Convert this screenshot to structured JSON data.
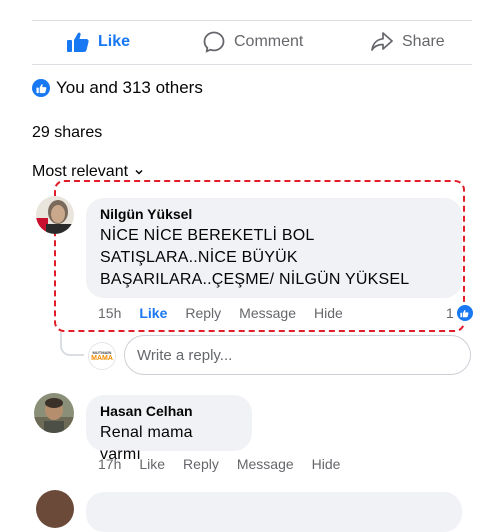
{
  "actions": {
    "like_label": "Like",
    "comment_label": "Comment",
    "share_label": "Share"
  },
  "reactions": {
    "summary": "You and 313 others"
  },
  "shares": {
    "text": "29 shares"
  },
  "sort": {
    "label": "Most relevant"
  },
  "comments": [
    {
      "author": "Nilgün Yüksel",
      "text": "NİCE NİCE BEREKETLİ BOL SATIŞLARA..NİCE BÜYÜK BAŞARILARA..ÇEŞME/ NİLGÜN YÜKSEL",
      "time": "15h",
      "like": "Like",
      "reply": "Reply",
      "message": "Message",
      "hide": "Hide",
      "reaction_count": "1"
    },
    {
      "author": "Hasan Celhan",
      "text": "Renal mama varmı",
      "time": "17h",
      "like": "Like",
      "reply": "Reply",
      "message": "Message",
      "hide": "Hide"
    }
  ],
  "reply_input": {
    "placeholder": "Write a reply...",
    "avatar_brand_top": "MUTMAİN",
    "avatar_brand_bottom": "MAMA"
  },
  "colors": {
    "accent": "#1877f2",
    "highlight_border": "#e11d2a",
    "bubble": "#f0f2f5",
    "muted": "#65676b"
  }
}
